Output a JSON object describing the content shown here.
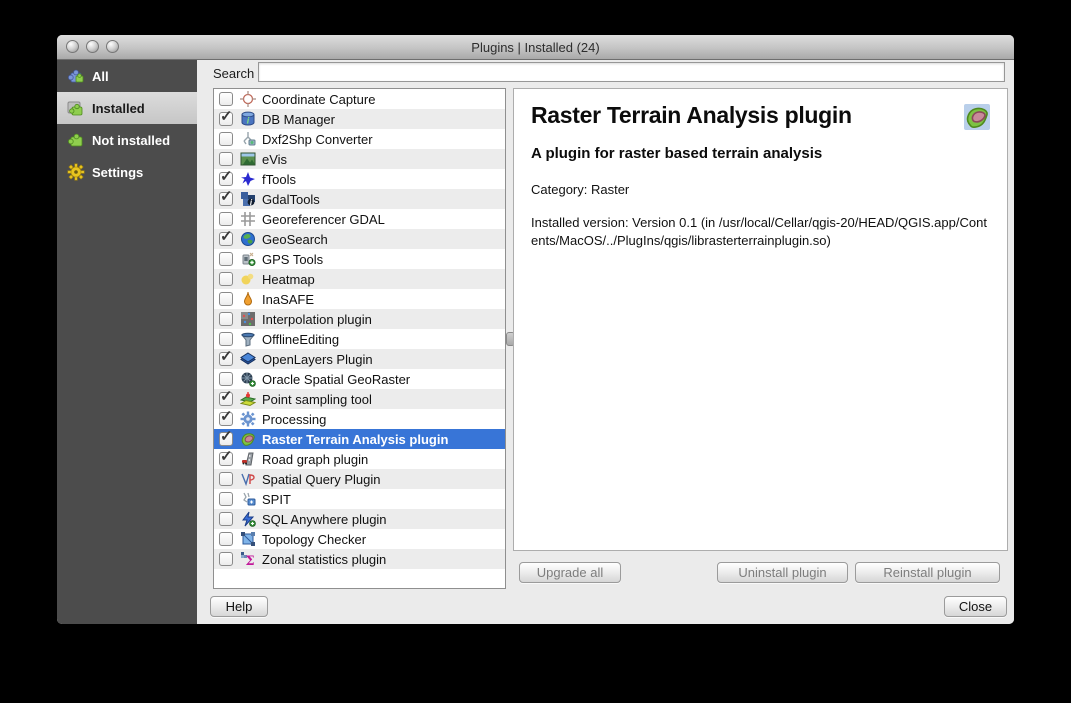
{
  "window": {
    "title": "Plugins | Installed (24)",
    "traffic_lights": [
      {
        "icon": "close-window-icon"
      },
      {
        "icon": "minimize-window-icon"
      },
      {
        "icon": "zoom-window-icon"
      }
    ]
  },
  "sidebar": {
    "items": [
      {
        "label": "All",
        "icon": "puzzle-all-icon",
        "selected": false
      },
      {
        "label": "Installed",
        "icon": "puzzle-installed-icon",
        "selected": true
      },
      {
        "label": "Not installed",
        "icon": "puzzle-not-installed-icon",
        "selected": false
      },
      {
        "label": "Settings",
        "icon": "gear-icon",
        "selected": false
      }
    ]
  },
  "search": {
    "label": "Search",
    "value": ""
  },
  "plugin_list": [
    {
      "name": "Coordinate Capture",
      "checked": false,
      "selected": false,
      "icon": "coordinate-capture-icon"
    },
    {
      "name": "DB Manager",
      "checked": true,
      "selected": false,
      "icon": "db-manager-icon"
    },
    {
      "name": "Dxf2Shp Converter",
      "checked": false,
      "selected": false,
      "icon": "dxf2shp-converter-icon"
    },
    {
      "name": "eVis",
      "checked": false,
      "selected": false,
      "icon": "evis-icon"
    },
    {
      "name": "fTools",
      "checked": true,
      "selected": false,
      "icon": "ftools-icon"
    },
    {
      "name": "GdalTools",
      "checked": true,
      "selected": false,
      "icon": "gdaltools-icon"
    },
    {
      "name": "Georeferencer GDAL",
      "checked": false,
      "selected": false,
      "icon": "georeferencer-gdal-icon"
    },
    {
      "name": "GeoSearch",
      "checked": true,
      "selected": false,
      "icon": "geosearch-icon"
    },
    {
      "name": "GPS Tools",
      "checked": false,
      "selected": false,
      "icon": "gps-tools-icon"
    },
    {
      "name": "Heatmap",
      "checked": false,
      "selected": false,
      "icon": "heatmap-icon"
    },
    {
      "name": "InaSAFE",
      "checked": false,
      "selected": false,
      "icon": "inasafe-icon"
    },
    {
      "name": "Interpolation plugin",
      "checked": false,
      "selected": false,
      "icon": "interpolation-icon"
    },
    {
      "name": "OfflineEditing",
      "checked": false,
      "selected": false,
      "icon": "offline-editing-icon"
    },
    {
      "name": "OpenLayers Plugin",
      "checked": true,
      "selected": false,
      "icon": "openlayers-icon"
    },
    {
      "name": "Oracle Spatial GeoRaster",
      "checked": false,
      "selected": false,
      "icon": "oracle-georaster-icon"
    },
    {
      "name": "Point sampling tool",
      "checked": true,
      "selected": false,
      "icon": "point-sampling-icon"
    },
    {
      "name": "Processing",
      "checked": true,
      "selected": false,
      "icon": "processing-icon"
    },
    {
      "name": "Raster Terrain Analysis plugin",
      "checked": true,
      "selected": true,
      "icon": "raster-terrain-icon"
    },
    {
      "name": "Road graph plugin",
      "checked": true,
      "selected": false,
      "icon": "road-graph-icon"
    },
    {
      "name": "Spatial Query Plugin",
      "checked": false,
      "selected": false,
      "icon": "spatial-query-icon"
    },
    {
      "name": "SPIT",
      "checked": false,
      "selected": false,
      "icon": "spit-icon"
    },
    {
      "name": "SQL Anywhere plugin",
      "checked": false,
      "selected": false,
      "icon": "sql-anywhere-icon"
    },
    {
      "name": "Topology Checker",
      "checked": false,
      "selected": false,
      "icon": "topology-checker-icon"
    },
    {
      "name": "Zonal statistics plugin",
      "checked": false,
      "selected": false,
      "icon": "zonal-statistics-icon"
    }
  ],
  "details": {
    "title": "Raster Terrain Analysis plugin",
    "icon": "raster-terrain-icon",
    "subtitle": "A plugin for raster based terrain analysis",
    "category_line": "Category: Raster",
    "installed_version_line": "Installed version: Version 0.1 (in /usr/local/Cellar/qgis-20/HEAD/QGIS.app/Contents/MacOS/../PlugIns/qgis/librasterterrainplugin.so)"
  },
  "buttons": {
    "upgrade_all": "Upgrade all",
    "uninstall": "Uninstall plugin",
    "reinstall": "Reinstall plugin",
    "help": "Help",
    "close": "Close"
  },
  "colors": {
    "selection_blue": "#3875d7",
    "sidebar_bg": "#4c4c4c",
    "window_bg": "#ebebeb",
    "row_alt": "#ececec",
    "check_mark": "#3a3a3a"
  }
}
